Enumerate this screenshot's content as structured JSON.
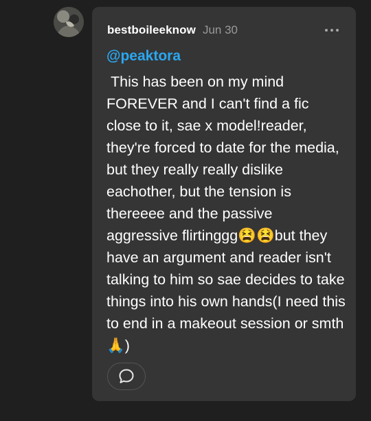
{
  "post": {
    "username": "bestboileeknow",
    "date": "Jun 30",
    "mention": "@peaktora",
    "body": " This has been on my mind FOREVER and I can't find a fic close to it, sae x model!reader, they're forced to date for the media, but they really really dislike eachother, but the tension is thereeee and the passive aggressive flirtinggg😫😫but they have an argument and reader isn't talking to him so sae decides to take things into his own hands(I need this to end in a makeout session or smth🙏)"
  },
  "icons": {
    "avatar": "user-avatar",
    "more": "more-options-icon",
    "reply": "speech-bubble-icon"
  },
  "colors": {
    "page_background": "#1f1f1f",
    "card_background": "#353535",
    "mention": "#2aa7f0",
    "date": "#9a9a9a"
  }
}
